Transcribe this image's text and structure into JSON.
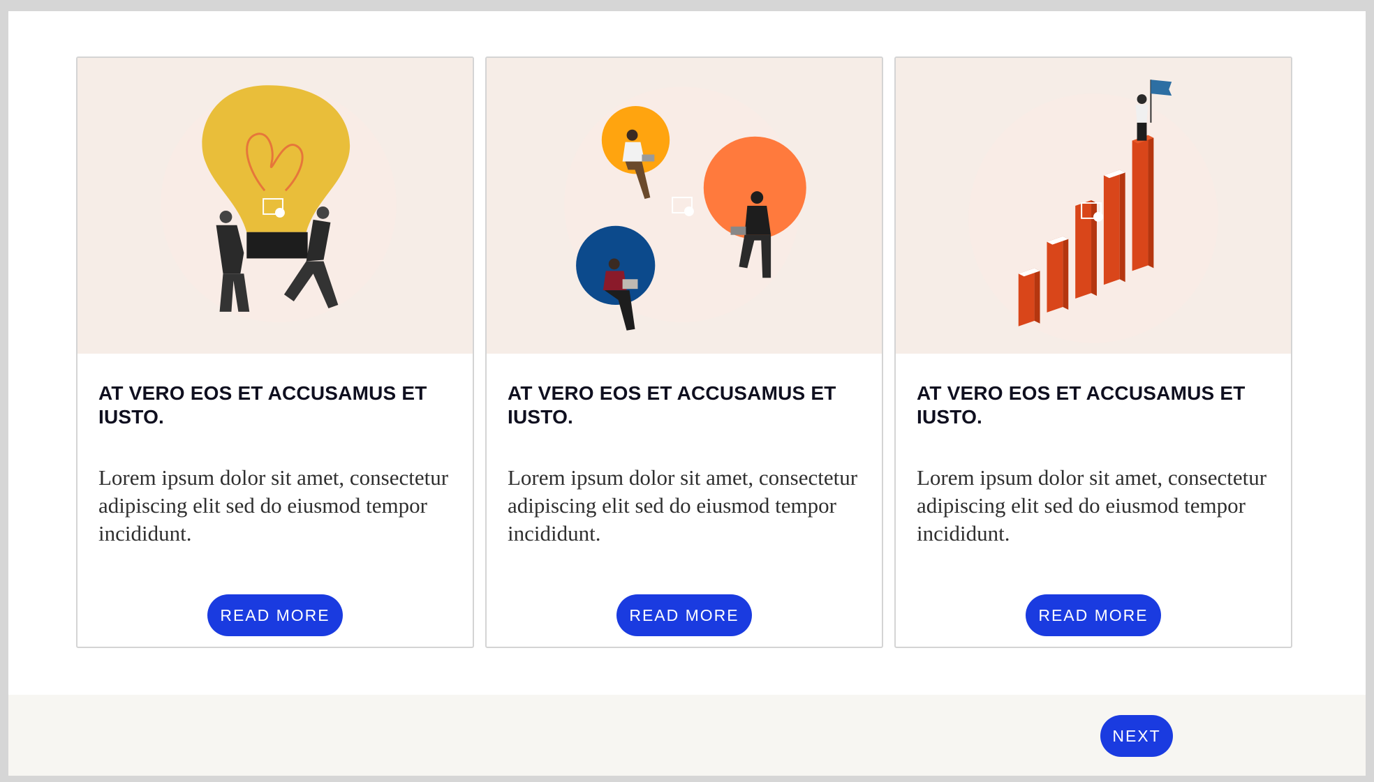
{
  "cards": [
    {
      "illustration": "lightbulb-carriers",
      "title": "AT VERO EOS ET ACCUSAMUS ET IUSTO.",
      "text": "Lorem ipsum dolor sit amet, consectetur adipiscing elit sed do eiusmod tempor incididunt.",
      "button": "READ MORE"
    },
    {
      "illustration": "people-in-circles",
      "title": "AT VERO EOS ET ACCUSAMUS ET IUSTO.",
      "text": "Lorem ipsum dolor sit amet, consectetur adipiscing elit sed do eiusmod tempor incididunt.",
      "button": "READ MORE"
    },
    {
      "illustration": "growth-bars-flag",
      "title": "AT VERO EOS ET ACCUSAMUS ET IUSTO.",
      "text": "Lorem ipsum dolor sit amet, consectetur adipiscing elit sed do eiusmod tempor incididunt.",
      "button": "READ MORE"
    }
  ],
  "footer": {
    "next_label": "NEXT"
  },
  "colors": {
    "accent": "#1a3be0",
    "media_bg": "#f6ede7",
    "bulb": "#e9be3a",
    "orange": "#ff7a3d",
    "amber": "#ffa40f",
    "navy": "#0c4a8c",
    "bars": "#d9461a",
    "flag": "#2d6fa3"
  }
}
